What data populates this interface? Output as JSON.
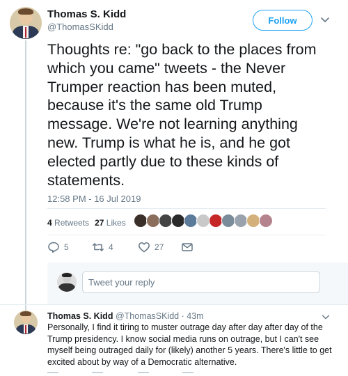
{
  "tweet": {
    "author_name": "Thomas S. Kidd",
    "author_handle": "@ThomasSKidd",
    "follow_label": "Follow",
    "text": "Thoughts re: \"go back to the places from which you came\" tweets - the Never Trumper reaction has been muted, because it's the same old Trump message. We're not learning anything new. Trump is what he is, and he got elected partly due to these kinds of statements.",
    "timestamp": "12:58 PM - 16 Jul 2019",
    "retweets_count": "4",
    "retweets_label": "Retweets",
    "likes_count": "27",
    "likes_label": "Likes",
    "actions": {
      "replies": "5",
      "retweets": "4",
      "likes": "27"
    },
    "reply_placeholder": "Tweet your reply"
  },
  "reply": {
    "author_name": "Thomas S. Kidd",
    "author_handle": "@ThomasSKidd",
    "separator": "·",
    "time": "43m",
    "text": "Personally, I find it tiring to muster outrage day after day after day of the Trump presidency. I know social media runs on outrage, but I can't see myself being outraged daily for (likely) another 5 years. There's little to get excited about by way of a Democratic alternative."
  },
  "icons": [
    "chevron-down-icon",
    "reply-icon",
    "retweet-icon",
    "like-icon",
    "direct-message-icon"
  ],
  "colors": {
    "accent": "#1da1f2",
    "text": "#14171a",
    "secondary_text": "#657786",
    "thread_line": "#ccd6dd",
    "reply_bar_bg": "#f5f8fa"
  },
  "likers": [
    "#3b2f2a",
    "#8a6d5a",
    "#444444",
    "#2a2a2a",
    "#5c7a9a",
    "#c9c9c9",
    "#c62828",
    "#7a8b99",
    "#9aa3ad",
    "#d4b07a",
    "#b5838d"
  ]
}
